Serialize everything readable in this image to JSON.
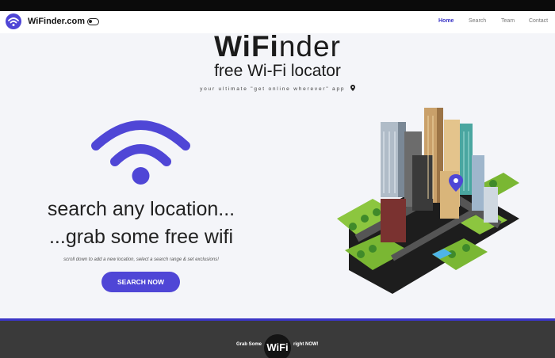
{
  "header": {
    "brand": "WiFinder.com",
    "nav": [
      "Home",
      "Search",
      "Team",
      "Contact"
    ]
  },
  "hero": {
    "title_bold": "WiFi",
    "title_light": "nder",
    "subtitle": "free Wi-Fi locator",
    "tagline": "your ultimate \"get online wherever\" app"
  },
  "main": {
    "line1": "search any location...",
    "line2": "...grab some free wifi",
    "hint": "scroll down to add a new location, select a search range & set exclusions!",
    "search_button": "SEARCH NOW"
  },
  "footer": {
    "grab": "Grab Some",
    "badge": "WiFi",
    "now": "right NOW!"
  },
  "colors": {
    "accent": "#4f46d6",
    "dark": "#3a3a3a",
    "background": "#f4f5f9"
  },
  "icons": [
    "wifi-logo-icon",
    "toggle-icon",
    "location-pin-icon",
    "wifi-icon",
    "city-illustration"
  ]
}
